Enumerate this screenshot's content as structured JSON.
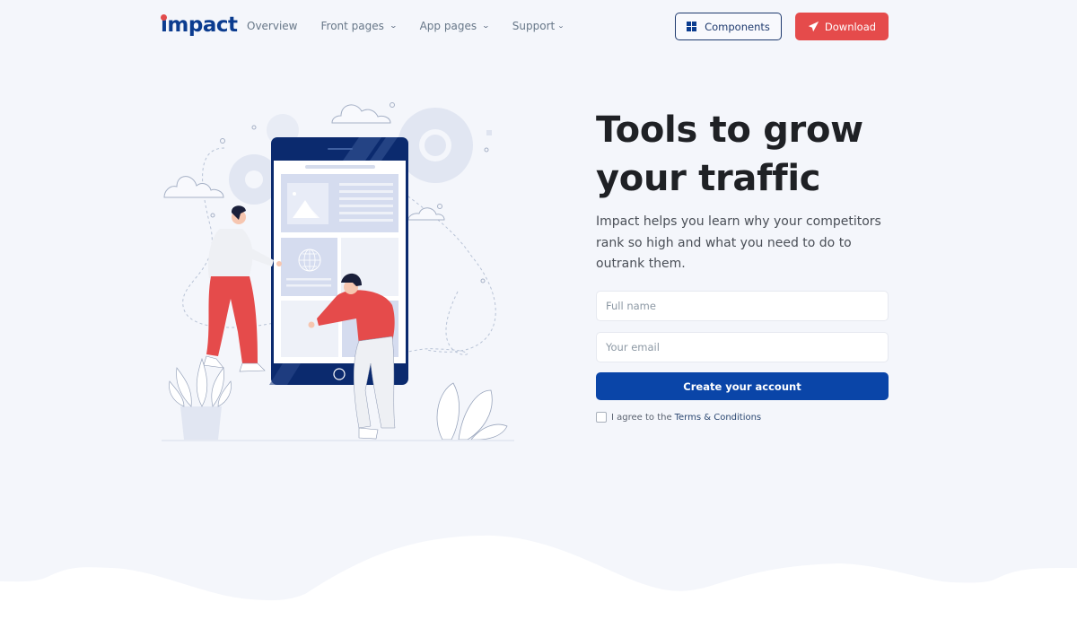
{
  "brand": {
    "logo_text": "impact",
    "accent_color": "#e54b4b",
    "primary_color": "#0a45a8",
    "dark_color": "#0b3c8f"
  },
  "nav": {
    "links": [
      {
        "label": "Overview",
        "has_dropdown": false
      },
      {
        "label": "Front pages",
        "has_dropdown": true
      },
      {
        "label": "App pages",
        "has_dropdown": true
      },
      {
        "label": "Support",
        "has_dropdown": true
      }
    ],
    "components_label": "Components",
    "components_icon": "grid-icon",
    "download_label": "Download",
    "download_icon": "paper-plane-icon"
  },
  "hero": {
    "title_line1": "Tools to grow",
    "title_line2": "your traffic",
    "description": "Impact helps you learn why your competitors rank so high and what you need to do to outrank them."
  },
  "form": {
    "full_name_placeholder": "Full name",
    "full_name_value": "",
    "email_placeholder": "Your email",
    "email_value": "",
    "submit_label": "Create your account",
    "agree_prefix": "I agree to the",
    "terms_label": "Terms & Conditions",
    "agree_checked": false
  },
  "illustration": {
    "description": "Two people interacting with a large smartphone showing a web page layout, with gears, clouds and plants"
  }
}
